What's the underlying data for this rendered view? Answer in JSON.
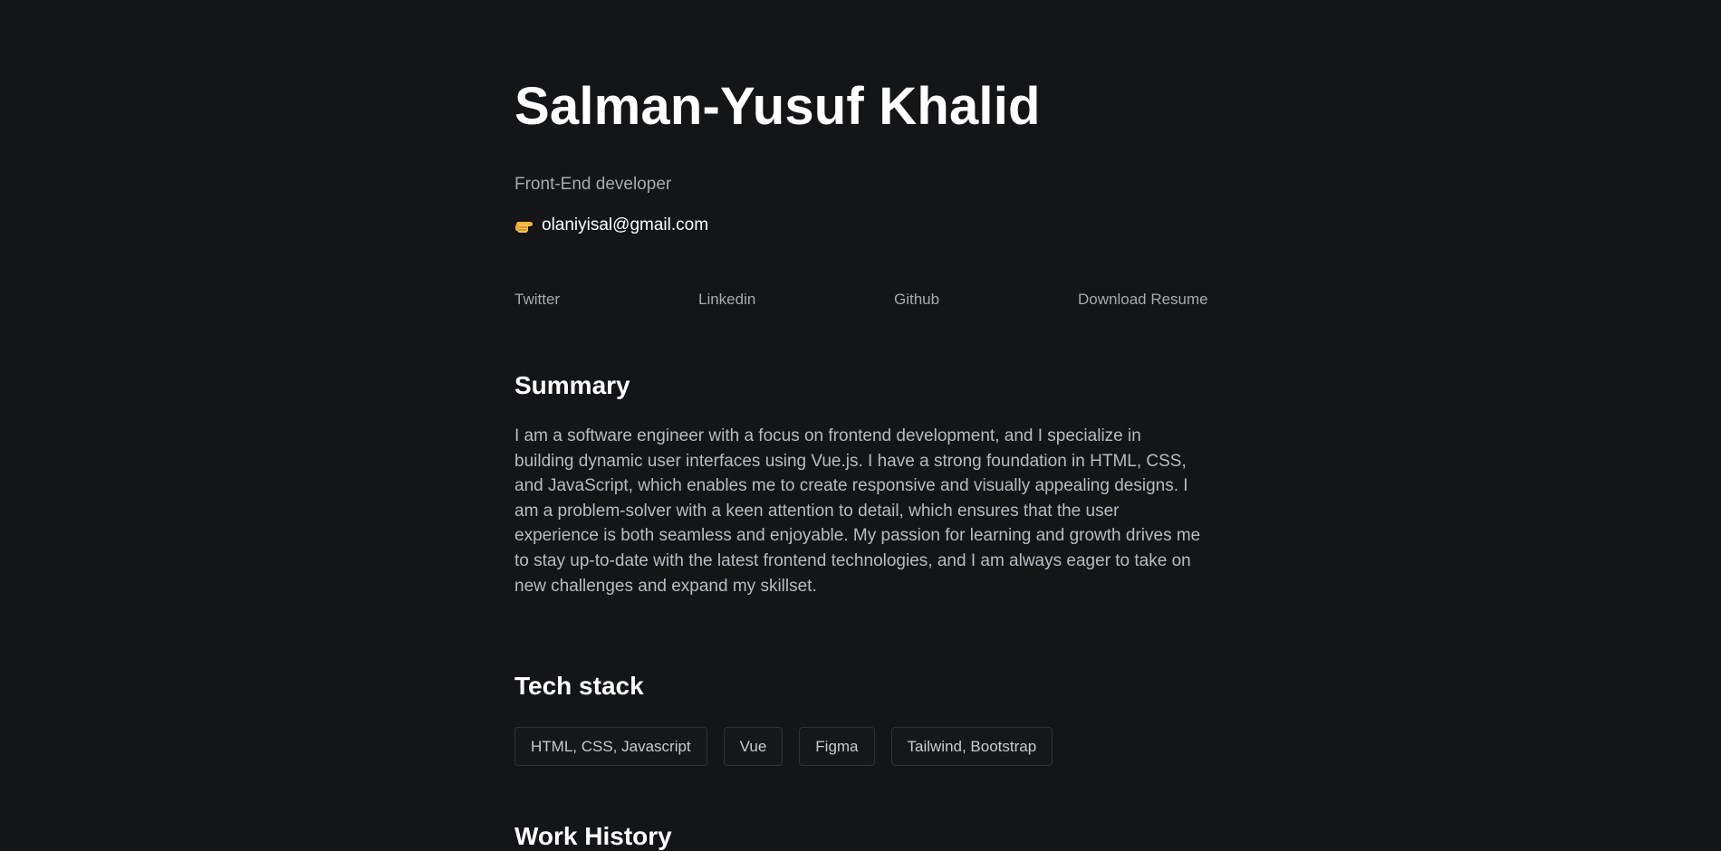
{
  "profile": {
    "name": "Salman-Yusuf Khalid",
    "role": "Front-End developer",
    "email": "olaniyisal@gmail.com",
    "email_icon": "pointing-hand-icon"
  },
  "links": {
    "twitter": "Twitter",
    "linkedin": "Linkedin",
    "github": "Github",
    "resume": "Download Resume"
  },
  "summary": {
    "title": "Summary",
    "text": "I am a software engineer with a focus on frontend development, and I specialize in building dynamic user interfaces using Vue.js. I have a strong foundation in HTML, CSS, and JavaScript, which enables me to create responsive and visually appealing designs. I am a problem-solver with a keen attention to detail, which ensures that the user experience is both seamless and enjoyable. My passion for learning and growth drives me to stay up-to-date with the latest frontend technologies, and I am always eager to take on new challenges and expand my skillset."
  },
  "tech_stack": {
    "title": "Tech stack",
    "items": [
      "HTML, CSS, Javascript",
      "Vue",
      "Figma",
      "Tailwind, Bootstrap"
    ]
  },
  "work_history": {
    "title": "Work History"
  },
  "colors": {
    "background": "#141517",
    "heading": "#ffffff",
    "muted_text": "#a7a9ad",
    "body_text": "#b9bbbf",
    "tag_border": "#2e3034"
  }
}
